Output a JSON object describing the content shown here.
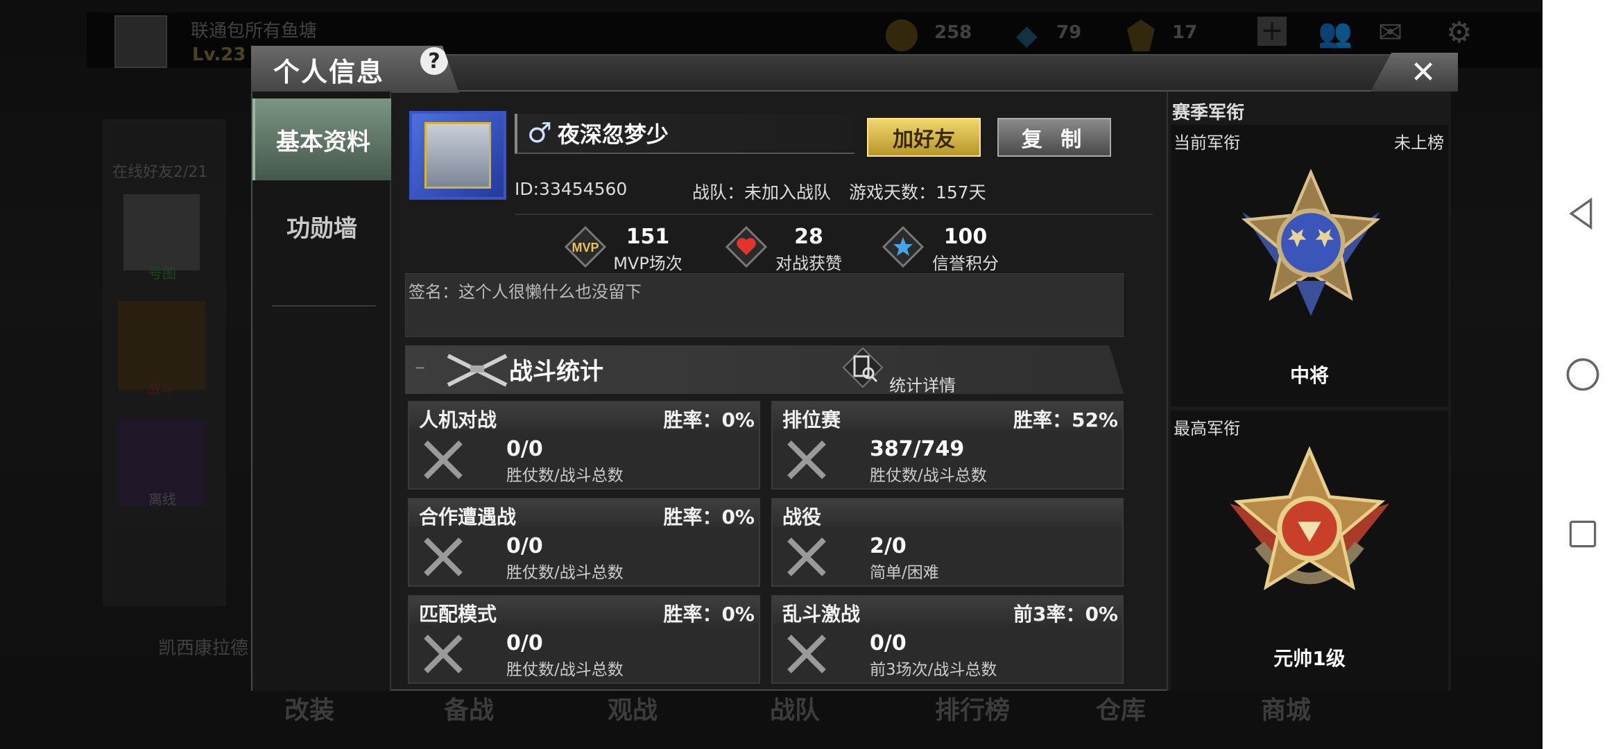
{
  "background": {
    "player_name": "联通包所有鱼塘",
    "player_level": "Lv.23",
    "currency_gold": "258",
    "currency_diamond": "79",
    "currency_medal": "17",
    "online_friends": "在线好友2/21",
    "friend_1_name": "号图",
    "friend_2_name": "战斗",
    "friend_3_name": "离线",
    "chat_preview": "凯西康拉德",
    "bottom_nav": [
      "改装",
      "备战",
      "观战",
      "战队",
      "排行榜",
      "仓库",
      "商城"
    ]
  },
  "dialog": {
    "title": "个人信息",
    "help_label": "?",
    "close_label": "✕"
  },
  "sidebar": {
    "tabs": [
      {
        "label": "基本资料",
        "active": true
      },
      {
        "label": "功勋墙",
        "active": false
      }
    ]
  },
  "profile": {
    "gender_icon": "male-icon",
    "name": "夜深忽梦少",
    "add_friend_label": "加好友",
    "copy_label": "复 制",
    "id_label": "ID:33454560",
    "team_label": "战队：未加入战队",
    "days_label": "游戏天数：157天",
    "stats": [
      {
        "icon": "mvp-icon",
        "value": "151",
        "label": "MVP场次"
      },
      {
        "icon": "heart-icon",
        "value": "28",
        "label": "对战获赞"
      },
      {
        "icon": "star-icon",
        "value": "100",
        "label": "信誉积分"
      }
    ],
    "signature": "签名：这个人很懒什么也没留下"
  },
  "battle": {
    "title": "战斗统计",
    "detail_label": "统计详情",
    "cards": [
      {
        "name": "人机对战",
        "rate": "胜率：0%",
        "value": "0/0",
        "sub": "胜仗数/战斗总数"
      },
      {
        "name": "排位赛",
        "rate": "胜率：52%",
        "value": "387/749",
        "sub": "胜仗数/战斗总数"
      },
      {
        "name": "合作遭遇战",
        "rate": "胜率：0%",
        "value": "0/0",
        "sub": "胜仗数/战斗总数"
      },
      {
        "name": "战役",
        "rate": "",
        "value": "2/0",
        "sub": "简单/困难"
      },
      {
        "name": "匹配模式",
        "rate": "胜率：0%",
        "value": "0/0",
        "sub": "胜仗数/战斗总数"
      },
      {
        "name": "乱斗激战",
        "rate": "前3率：0%",
        "value": "0/0",
        "sub": "前3场次/战斗总数"
      }
    ]
  },
  "rank": {
    "season_title": "赛季军衔",
    "current_label": "当前军衔",
    "current_status": "未上榜",
    "current_rank": "中将",
    "highest_label": "最高军衔",
    "highest_rank": "元帅1级"
  },
  "colors": {
    "accent_gold": "#f0d66e",
    "active_tab": "#7b9583",
    "dialog_bg": "#1b1b1b"
  }
}
